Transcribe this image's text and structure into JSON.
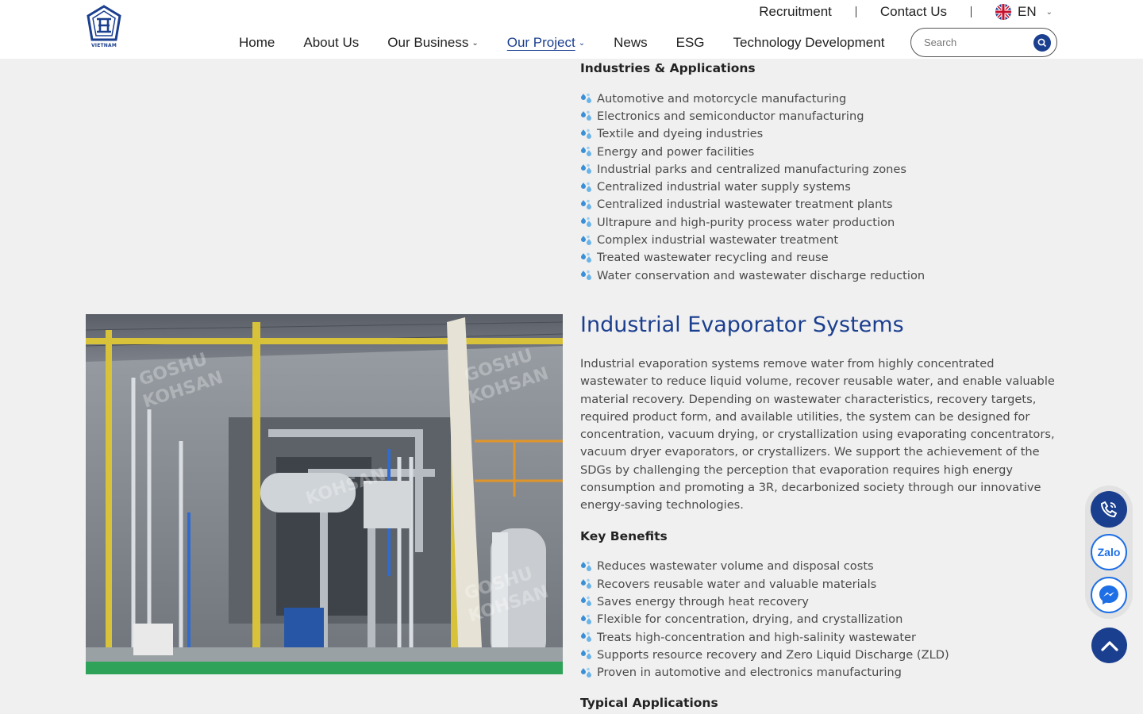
{
  "header": {
    "logo_caption": "VIETNAM",
    "topbar": {
      "recruitment": "Recruitment",
      "contact": "Contact Us",
      "language": "EN"
    },
    "nav": [
      {
        "label": "Home"
      },
      {
        "label": "About Us"
      },
      {
        "label": "Our Business"
      },
      {
        "label": "Our Project"
      },
      {
        "label": "News"
      },
      {
        "label": "ESG"
      },
      {
        "label": "Technology Development"
      }
    ],
    "search": {
      "placeholder": "Search"
    }
  },
  "section1": {
    "heading": "Industries & Applications",
    "items": [
      "Automotive and motorcycle manufacturing",
      "Electronics and semiconductor manufacturing",
      "Textile and dyeing industries",
      "Energy and power facilities",
      "Industrial parks and centralized manufacturing zones",
      "Centralized industrial water supply systems",
      "Centralized industrial wastewater treatment plants",
      "Ultrapure and high-purity process water production",
      "Complex industrial wastewater treatment",
      "Treated wastewater recycling and reuse",
      "Water conservation and wastewater discharge reduction"
    ]
  },
  "section2": {
    "title": "Industrial Evaporator Systems",
    "description": "Industrial evaporation systems remove water from highly concentrated wastewater to reduce liquid volume, recover reusable water, and enable valuable material recovery. Depending on wastewater characteristics, recovery targets, required product form, and available utilities, the system can be designed for concentration, vacuum drying, or crystallization using evaporating concentrators, vacuum dryer evaporators, or crystallizers. We support the achievement of the SDGs by challenging the perception that evaporation requires high energy consumption and promoting a 3R, decarbonized society through our innovative energy-saving technologies.",
    "benefits_heading": "Key Benefits",
    "benefits": [
      "Reduces wastewater volume and disposal costs",
      "Recovers reusable water and valuable materials",
      "Saves energy through heat recovery",
      "Flexible for concentration, drying, and crystallization",
      "Treats high-concentration and high-salinity wastewater",
      "Supports resource recovery and Zero Liquid Discharge (ZLD)",
      "Proven in automotive and electronics manufacturing"
    ],
    "applications_heading": "Typical Applications",
    "photo_watermark": [
      "GOSHU",
      "KOHSAN"
    ]
  },
  "floating": {
    "zalo_label": "Zalo"
  },
  "colors": {
    "brand_blue": "#1b3f8f",
    "page_bg": "#f0f0f0",
    "bullet_blue": "#3a8fd6",
    "messenger_blue": "#1e6fe6"
  }
}
